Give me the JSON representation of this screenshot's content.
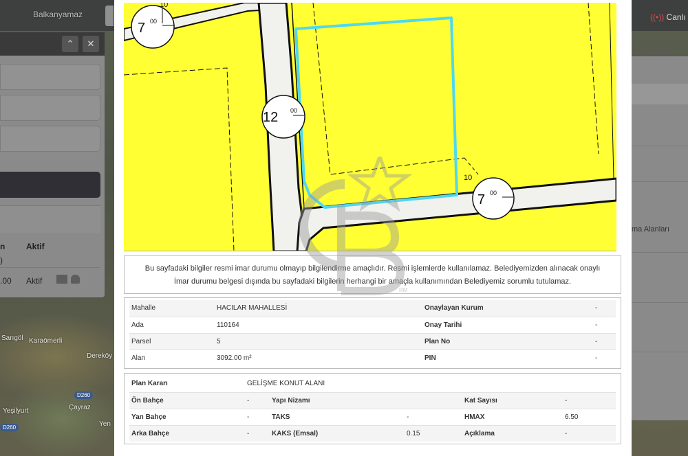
{
  "background": {
    "top_labels": [
      "Balkanyamaz"
    ],
    "right_link": "Canlı",
    "map_labels": [
      "Sarıgöl",
      "Karaömerli",
      "Dereköy",
      "Yeşilyurt",
      "Çayraz",
      "Yen"
    ],
    "road_badges": [
      "D260",
      "D260"
    ],
    "right_panel_text": [
      "ma Alanları",
      "ma Alanları"
    ]
  },
  "left_panel": {
    "col1_head": "n",
    "col2_head": "Aktif",
    "row_col1_a": ")",
    "row_col1_b": ".00",
    "row_col2": "Aktif"
  },
  "map": {
    "labels": {
      "road_left": "7",
      "road_left_sup": "00",
      "road_center": "12",
      "road_center_sup": "00",
      "road_right": "7",
      "road_right_sup": "00",
      "setback_a": "10",
      "setback_b": "10"
    },
    "colors": {
      "zone": "#ffff33",
      "parcel_outline": "#4fd8f0",
      "road": "#f1f1ee"
    }
  },
  "disclaimer": {
    "line1": "Bu sayfadaki bilgiler resmi imar durumu olmayıp bilgilendirme amaçlıdır. Resmi işlemlerde kullanılamaz. Belediyemizden alınacak onaylı",
    "line2": "İmar durumu belgesi dışında bu sayfadaki bilgilerin herhangi bir amaçla kullanımından Belediyemiz sorumlu tutulamaz."
  },
  "parcel_info": {
    "rows": [
      {
        "label": "Mahalle",
        "value": "HACILAR MAHALLESİ",
        "label2": "Onaylayan Kurum",
        "value2": "-"
      },
      {
        "label": "Ada",
        "value": "110164",
        "label2": "Onay Tarihi",
        "value2": "-"
      },
      {
        "label": "Parsel",
        "value": "5",
        "label2": "Plan No",
        "value2": "-"
      },
      {
        "label": "Alan",
        "value": "3092.00 m²",
        "label2": "PIN",
        "value2": "-"
      }
    ]
  },
  "plan_info": {
    "plan_karari_label": "Plan Kararı",
    "plan_karari_value": "GELİŞME KONUT ALANI",
    "rows": [
      {
        "a_label": "Ön Bahçe",
        "a_value": "-",
        "b_label": "Yapı Nizamı",
        "b_value": "",
        "c_label": "Kat Sayısı",
        "c_value": "-"
      },
      {
        "a_label": "Yan Bahçe",
        "a_value": "-",
        "b_label": "TAKS",
        "b_value": "-",
        "c_label": "HMAX",
        "c_value": "6.50"
      },
      {
        "a_label": "Arka Bahçe",
        "a_value": "-",
        "b_label": "KAKS (Emsal)",
        "b_value": "0.15",
        "c_label": "Açıklama",
        "c_value": "-"
      }
    ]
  },
  "watermark": {
    "text": "CB",
    "sub": "RM"
  }
}
